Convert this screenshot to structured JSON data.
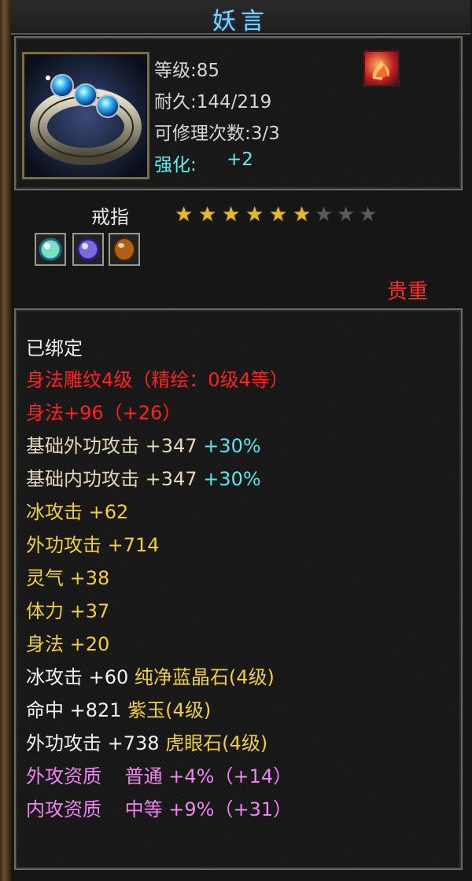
{
  "title": "妖言",
  "item": {
    "level": "等级:85",
    "durability": "耐久:144/219",
    "repair": "可修理次数:3/3",
    "enhance_label": "强化:",
    "enhance_value": "+2",
    "type": "戒指",
    "quality": "贵重",
    "stars_filled": 6,
    "stars_total": 9
  },
  "gems": [
    "green-gem-icon",
    "purple-gem-icon",
    "amber-gem-icon"
  ],
  "colors": {
    "red": "#ff2020",
    "cyan": "#55e8f0",
    "yellow": "#f0cf3a",
    "pink": "#ee86ee",
    "beige": "#e6d8b8"
  },
  "attrs": {
    "bound": "已绑定",
    "engrave": "身法雕纹4级（精绘：0级4等）",
    "agi_base": "身法+96（+26）",
    "ext_atk_base": "基础外功攻击 +347",
    "ext_atk_pct": "+30%",
    "int_atk_base": "基础内功攻击 +347",
    "int_atk_pct": "+30%",
    "ice_atk": "冰攻击 +62",
    "ext_atk": "外功攻击 +714",
    "spirit": "灵气 +38",
    "stamina": "体力 +37",
    "agi": "身法 +20",
    "gem1_stat": "冰攻击 +60",
    "gem1_name": "纯净蓝晶石(4级)",
    "gem2_stat": "命中 +821",
    "gem2_name": "紫玉(4级)",
    "gem3_stat": "外功攻击 +738",
    "gem3_name": "虎眼石(4级)",
    "q1_label": "外攻资质",
    "q1_grade": "普通",
    "q1_value": "+4%（+14）",
    "q2_label": "内攻资质",
    "q2_grade": "中等",
    "q2_value": "+9%（+31）"
  }
}
